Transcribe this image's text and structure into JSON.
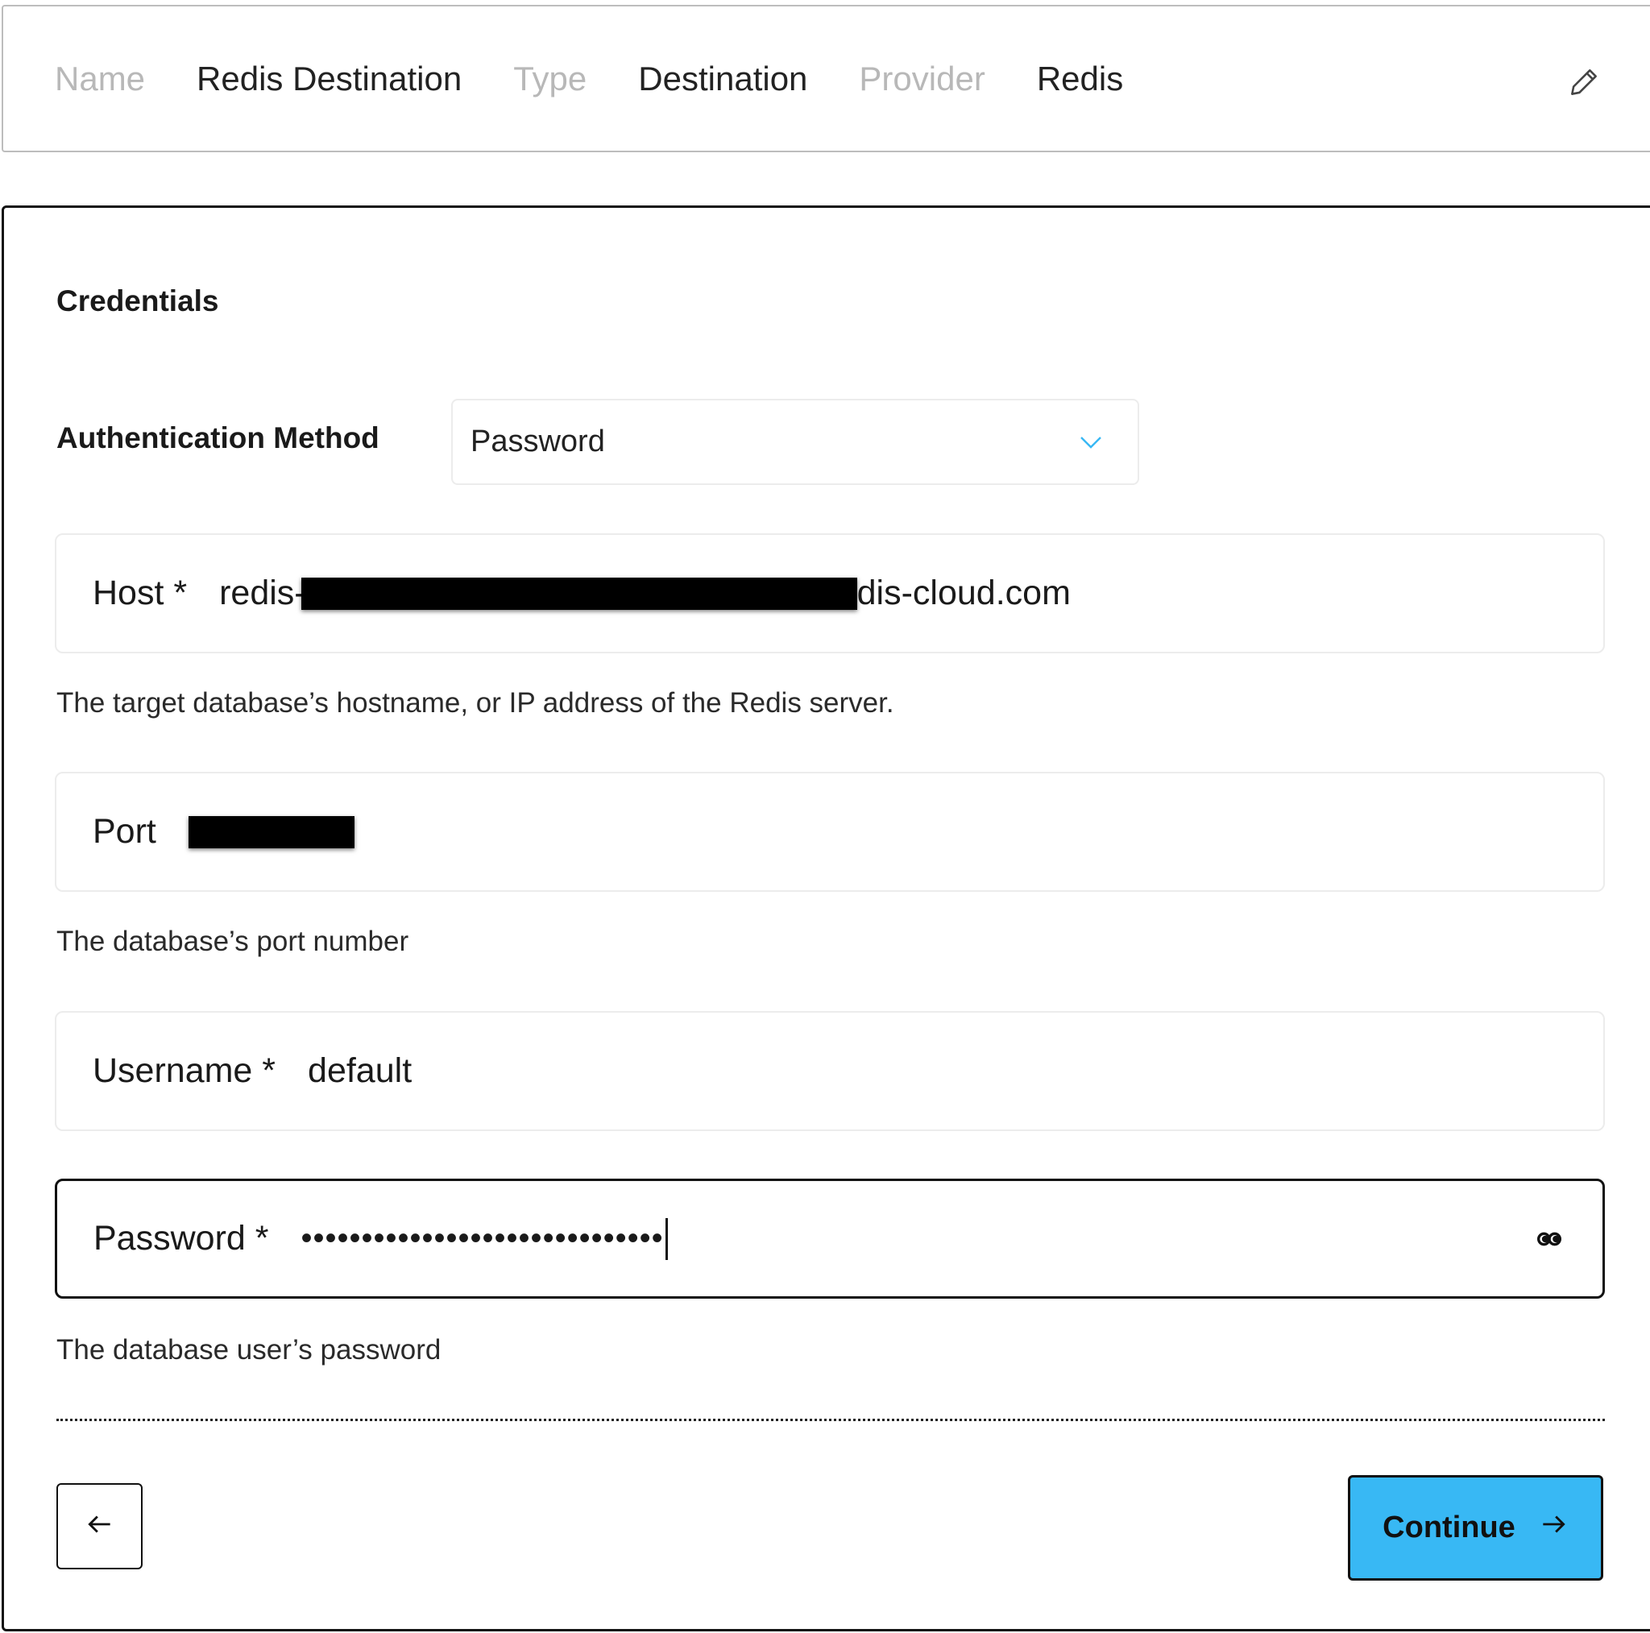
{
  "summary": {
    "name_label": "Name",
    "name_value": "Redis Destination",
    "type_label": "Type",
    "type_value": "Destination",
    "provider_label": "Provider",
    "provider_value": "Redis"
  },
  "credentials": {
    "title": "Credentials",
    "auth_method_label": "Authentication Method",
    "auth_method_value": "Password",
    "host": {
      "label": "Host *",
      "value_prefix": "redis-",
      "value_suffix": "dis-cloud.com",
      "hint": "The target database’s hostname, or IP address of the Redis server."
    },
    "port": {
      "label": "Port",
      "hint": "The database’s port number"
    },
    "username": {
      "label": "Username *",
      "value": "default"
    },
    "password": {
      "label": "Password *",
      "masked_value": "••••••••••••••••••••••••••••••",
      "hint": "The database user’s password"
    }
  },
  "footer": {
    "continue_label": "Continue"
  },
  "colors": {
    "accent": "#38b8f4",
    "label_muted": "#b8b8b8"
  },
  "icons": {
    "edit": "pencil-icon",
    "dropdown": "chevron-down-icon",
    "reveal": "eye-icon",
    "back": "arrow-left-icon",
    "forward": "arrow-right-icon"
  }
}
